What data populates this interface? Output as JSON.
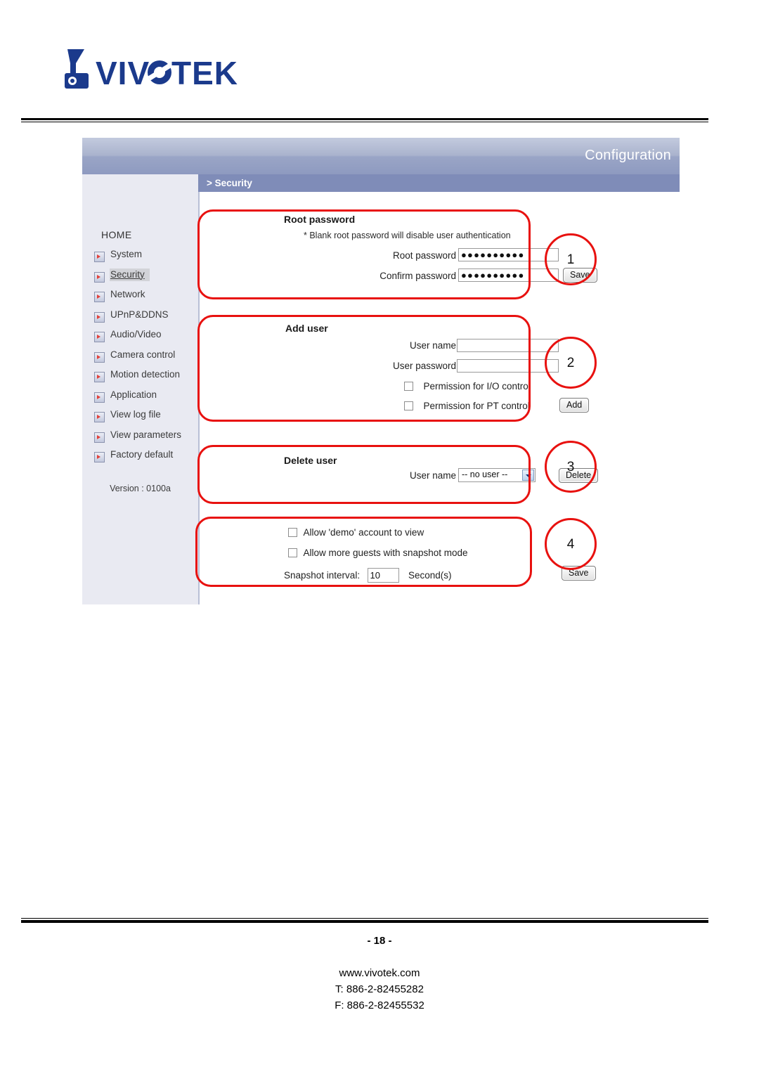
{
  "brand": {
    "name": "VIVOTEK",
    "logo_icon": "vivotek-camera-logo"
  },
  "app": {
    "header_title": "Configuration",
    "breadcrumb": "> Security",
    "sidebar": {
      "home_label": "HOME",
      "items": [
        {
          "label": "System",
          "icon": "arrow-bullet-icon"
        },
        {
          "label": "Security",
          "icon": "arrow-bullet-icon"
        },
        {
          "label": "Network",
          "icon": "arrow-bullet-icon"
        },
        {
          "label": "UPnP&DDNS",
          "icon": "arrow-bullet-icon"
        },
        {
          "label": "Audio/Video",
          "icon": "arrow-bullet-icon"
        },
        {
          "label": "Camera control",
          "icon": "arrow-bullet-icon"
        },
        {
          "label": "Motion detection",
          "icon": "arrow-bullet-icon"
        },
        {
          "label": "Application",
          "icon": "arrow-bullet-icon"
        },
        {
          "label": "View log file",
          "icon": "arrow-bullet-icon"
        },
        {
          "label": "View parameters",
          "icon": "arrow-bullet-icon"
        },
        {
          "label": "Factory default",
          "icon": "arrow-bullet-icon"
        }
      ],
      "current": "Security",
      "version": "Version : 0100a"
    },
    "root_password": {
      "title": "Root password",
      "note": "* Blank root password will disable user authentication",
      "root_label": "Root password",
      "root_value": "●●●●●●●●●●",
      "confirm_label": "Confirm password",
      "confirm_value": "●●●●●●●●●●",
      "save_label": "Save"
    },
    "add_user": {
      "title": "Add user",
      "username_label": "User name",
      "username_value": "",
      "username_placeholder": "",
      "password_label": "User password",
      "password_value": "",
      "password_placeholder": "",
      "perm_io_label": "Permission for I/O control",
      "perm_io_checked": false,
      "perm_pt_label": "Permission for PT control",
      "perm_pt_checked": false,
      "add_label": "Add"
    },
    "delete_user": {
      "title": "Delete user",
      "username_label": "User name",
      "selected_option": "-- no user --",
      "options": [
        "-- no user --"
      ],
      "delete_label": "Delete"
    },
    "guest_options": {
      "demo_label": "Allow 'demo' account to view",
      "demo_checked": false,
      "guests_label": "Allow more guests with snapshot mode",
      "guests_checked": false,
      "interval_label": "Snapshot interval:",
      "interval_value": "10",
      "interval_unit": "Second(s)",
      "save_label": "Save"
    }
  },
  "annotations": {
    "callouts": [
      "1",
      "2",
      "3",
      "4"
    ],
    "color": "#e8110f"
  },
  "footer": {
    "page": "- 18 -",
    "website": "www.vivotek.com",
    "tel": "T: 886-2-82455282",
    "fax": "F: 886-2-82455532"
  }
}
